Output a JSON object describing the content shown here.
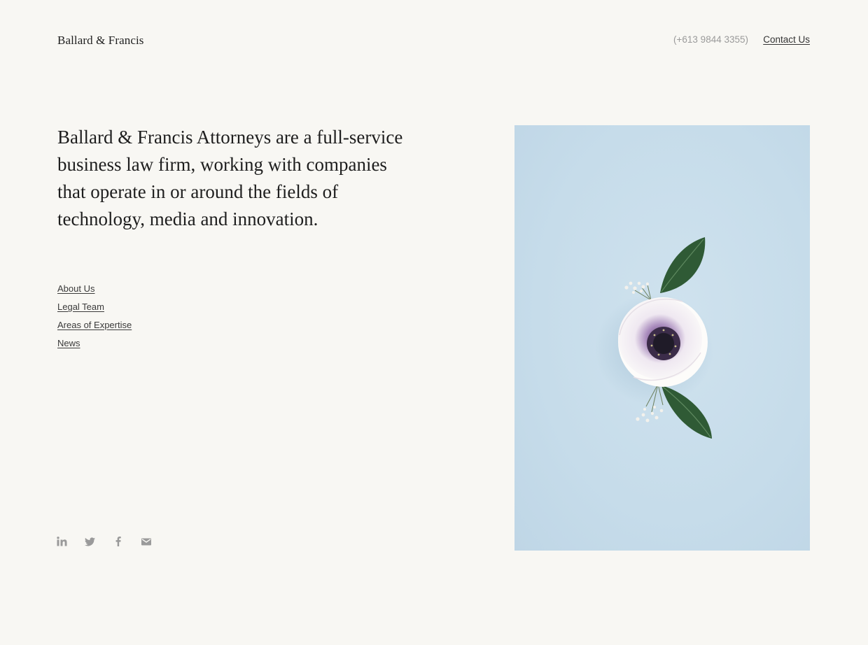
{
  "header": {
    "logo": "Ballard & Francis",
    "phone": "(+613 9844 3355)",
    "contact_label": "Contact Us"
  },
  "intro": {
    "text": "Ballard & Francis Attorneys are a full-service business law firm, working with companies that operate in or around the fields of technology, media and innovation."
  },
  "nav": {
    "items": [
      {
        "label": "About Us"
      },
      {
        "label": "Legal Team"
      },
      {
        "label": "Areas of Expertise"
      },
      {
        "label": "News"
      }
    ]
  },
  "social": {
    "icons": [
      "linkedin-icon",
      "twitter-icon",
      "facebook-icon",
      "mail-icon"
    ],
    "color": "#9a9a9a"
  },
  "photo": {
    "subject": "white-purple anemone flower with green leaves on pale blue background",
    "background_color": "#c6dcea"
  },
  "colors": {
    "page_background": "#f8f7f3",
    "text": "#1e1e1e"
  }
}
